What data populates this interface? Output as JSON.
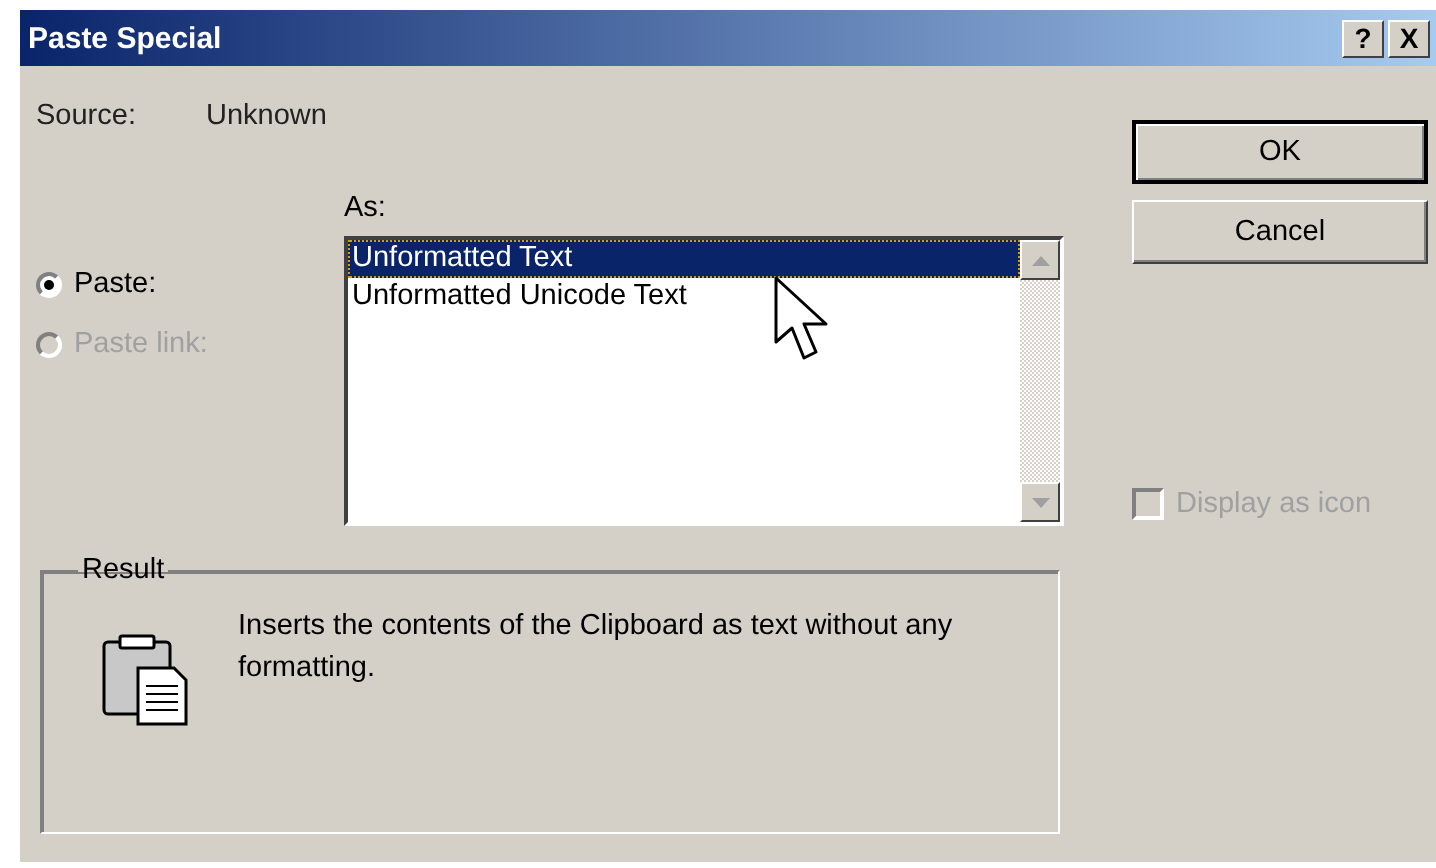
{
  "window": {
    "title": "Paste Special",
    "buttons": [
      {
        "label": "?"
      },
      {
        "label": "X"
      }
    ]
  },
  "source": {
    "label": "Source:",
    "value": "Unknown"
  },
  "paste_options": [
    {
      "label": "Paste:",
      "selected": true,
      "disabled": false
    },
    {
      "label": "Paste link:",
      "selected": false,
      "disabled": true
    }
  ],
  "as_list": {
    "label": "As:",
    "items": [
      {
        "label": "Unformatted Text",
        "selected": true
      },
      {
        "label": "Unformatted Unicode Text",
        "selected": false
      }
    ]
  },
  "result": {
    "title": "Result",
    "text": "Inserts the contents of the Clipboard as text without any formatting."
  },
  "buttons": [
    {
      "label": "OK",
      "default": true
    },
    {
      "label": "Cancel",
      "default": false
    }
  ],
  "display_as_icon": {
    "label": "Display as icon",
    "checked": false,
    "disabled": true
  }
}
